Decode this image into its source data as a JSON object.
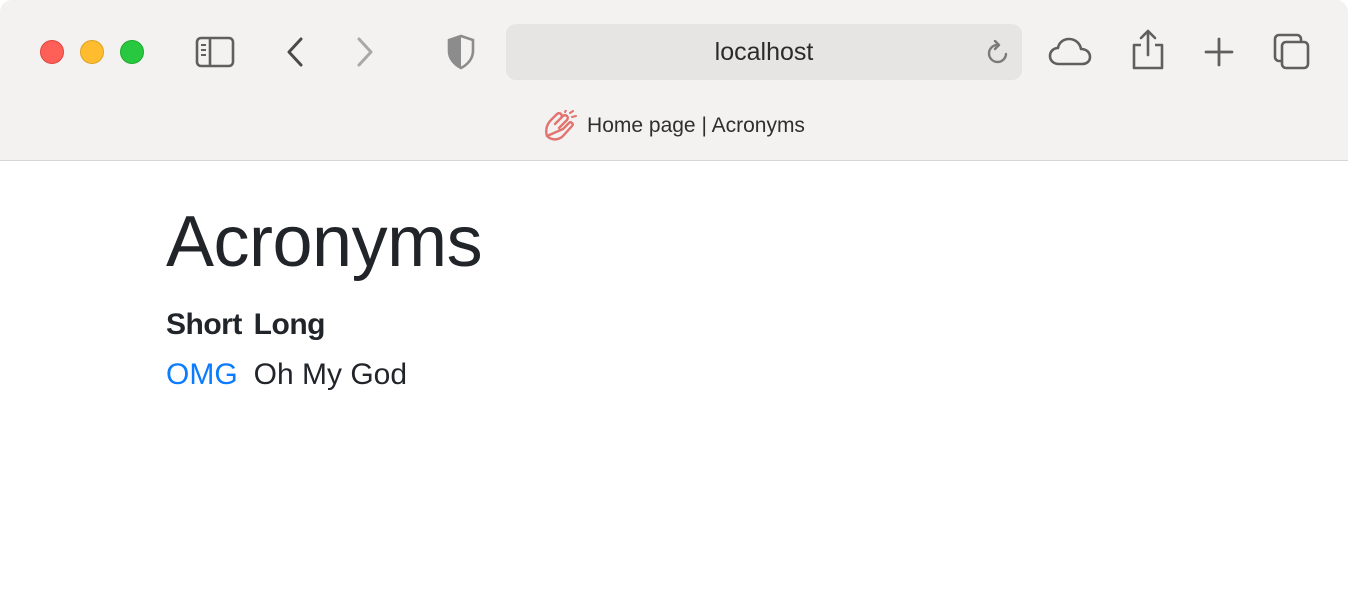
{
  "browser": {
    "address": "localhost",
    "tab_title": "Home page | Acronyms",
    "colors": {
      "close": "#fe5f57",
      "minimize": "#febc2e",
      "maximize": "#28c840",
      "favicon": "#e2736f"
    },
    "icons": [
      "sidebar-icon",
      "back-icon",
      "forward-icon",
      "shield-icon",
      "reload-icon",
      "cloud-icon",
      "share-icon",
      "new-tab-icon",
      "tabs-overview-icon",
      "favicon-hand-icon"
    ]
  },
  "page": {
    "heading": "Acronyms",
    "table": {
      "headers": [
        "Short",
        "Long"
      ],
      "rows": [
        {
          "short": "OMG",
          "long": "Oh My God"
        }
      ]
    },
    "link_color": "#0b7bff"
  }
}
